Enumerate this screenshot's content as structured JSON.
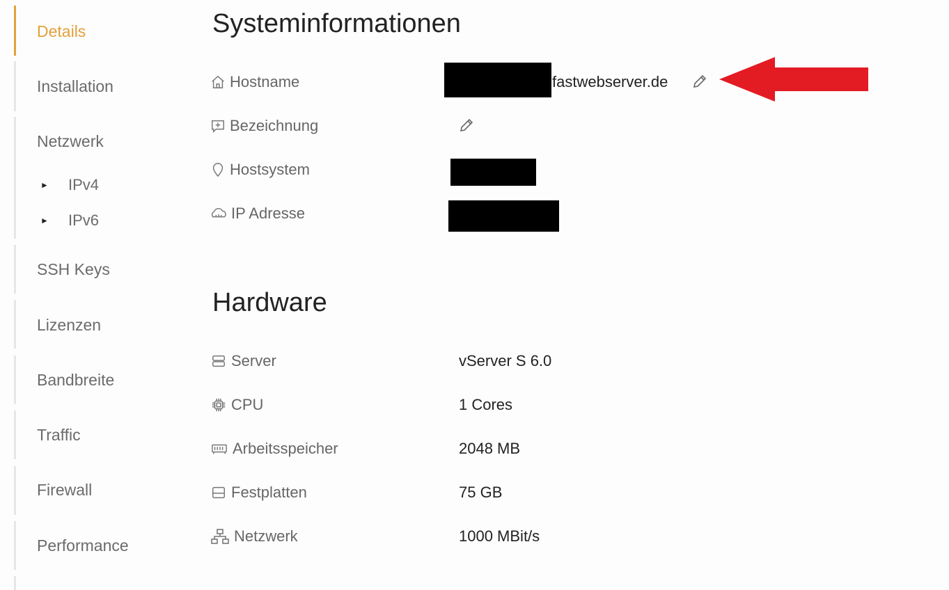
{
  "sidebar": {
    "items": [
      {
        "label": "Details",
        "active": true
      },
      {
        "label": "Installation"
      },
      {
        "label": "Netzwerk"
      },
      {
        "label": "SSH Keys"
      },
      {
        "label": "Lizenzen"
      },
      {
        "label": "Bandbreite"
      },
      {
        "label": "Traffic"
      },
      {
        "label": "Firewall"
      },
      {
        "label": "Performance"
      }
    ],
    "subitems": [
      {
        "label": "IPv4",
        "icon": "triangle-right-icon"
      },
      {
        "label": "IPv6",
        "icon": "triangle-right-icon"
      }
    ]
  },
  "system": {
    "title": "Systeminformationen",
    "rows": [
      {
        "label": "Hostname",
        "icon": "home-icon",
        "value": "fastwebserver.de"
      },
      {
        "label": "Bezeichnung",
        "icon": "comment-plus-icon",
        "value": ""
      },
      {
        "label": "Hostsystem",
        "icon": "map-pin-icon",
        "value": ""
      },
      {
        "label": "IP Adresse",
        "icon": "cloud-icon",
        "value": ""
      }
    ]
  },
  "hardware": {
    "title": "Hardware",
    "rows": [
      {
        "label": "Server",
        "icon": "server-icon",
        "value": "vServer S 6.0"
      },
      {
        "label": "CPU",
        "icon": "cpu-icon",
        "value": "1 Cores"
      },
      {
        "label": "Arbeitsspeicher",
        "icon": "memory-icon",
        "value": "2048 MB"
      },
      {
        "label": "Festplatten",
        "icon": "hdd-icon",
        "value": "75 GB"
      },
      {
        "label": "Netzwerk",
        "icon": "network-icon",
        "value": "1000 MBit/s"
      }
    ]
  },
  "colors": {
    "accent": "#e3a13a",
    "arrow": "#e31b23"
  }
}
